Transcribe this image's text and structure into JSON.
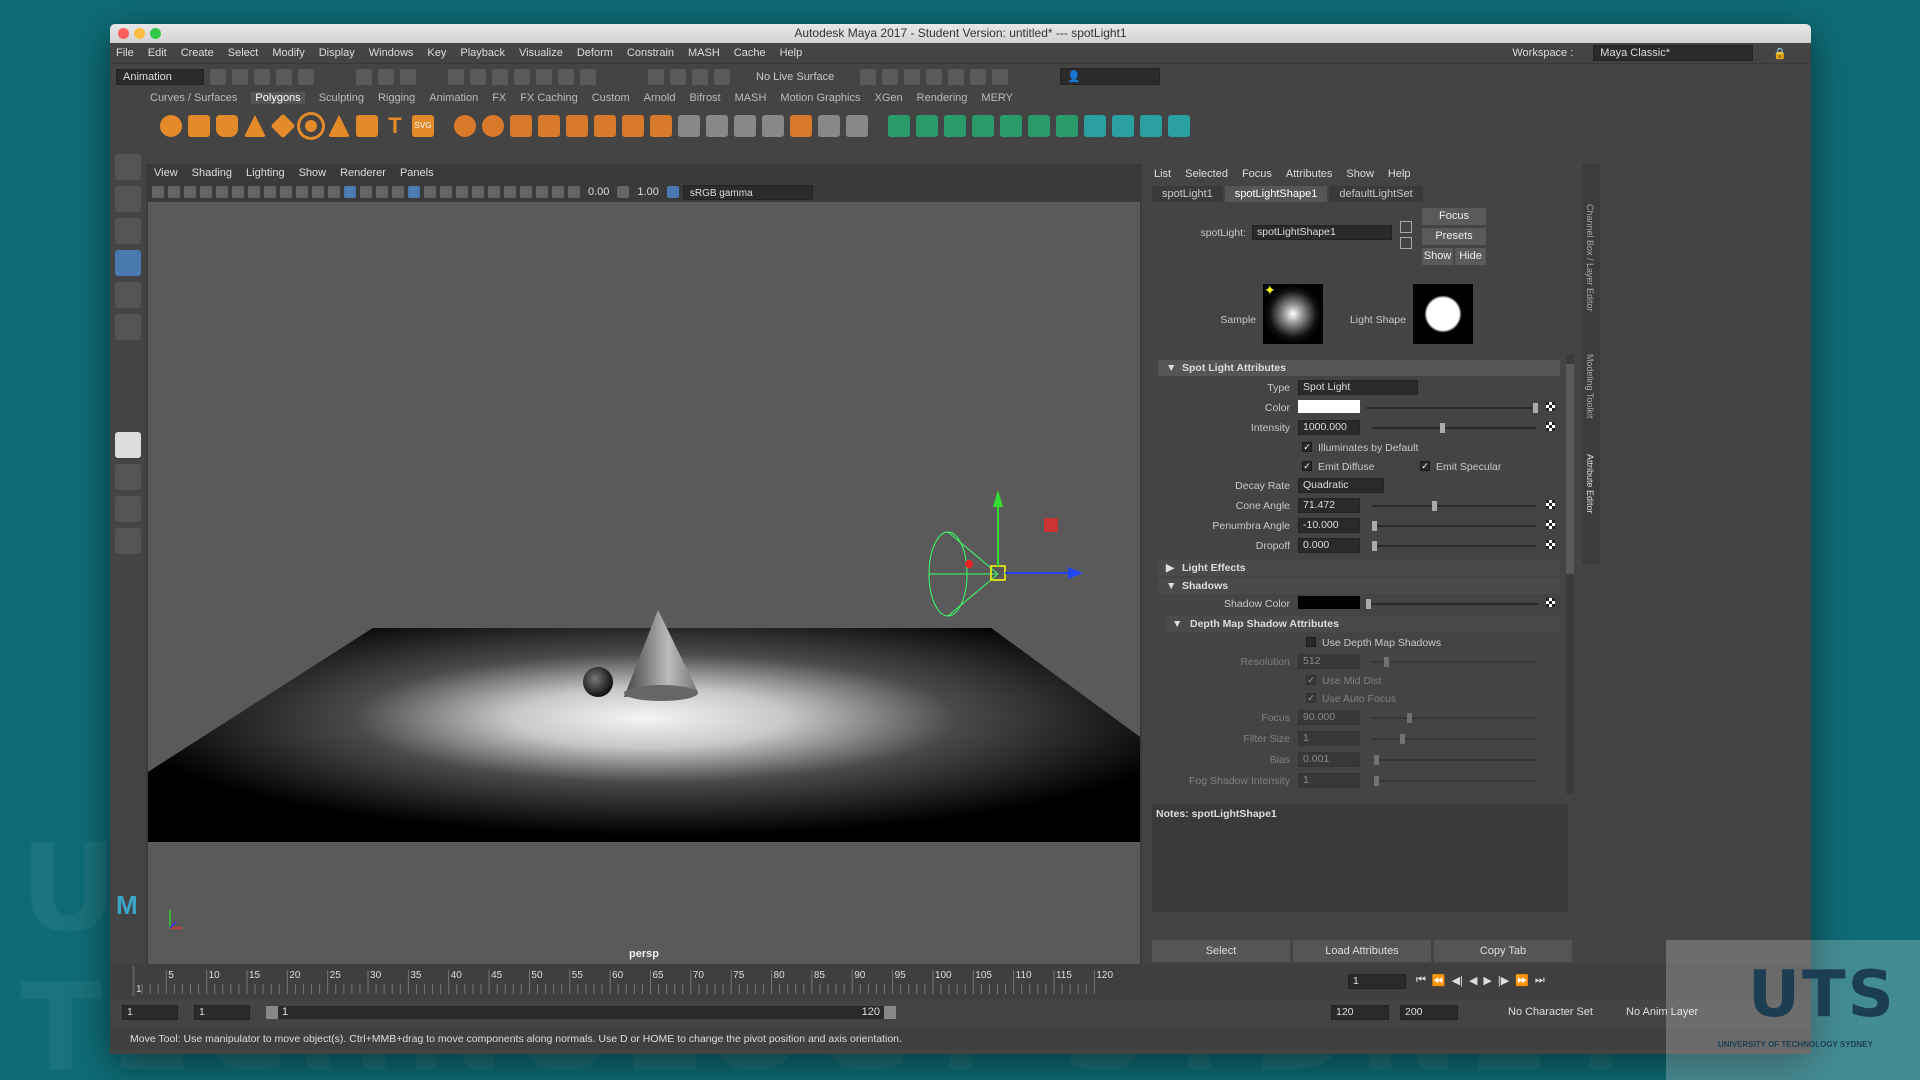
{
  "window": {
    "title": "Autodesk Maya 2017 - Student Version: untitled*   ---   spotLight1"
  },
  "menus": [
    "File",
    "Edit",
    "Create",
    "Select",
    "Modify",
    "Display",
    "Windows",
    "Key",
    "Playback",
    "Visualize",
    "Deform",
    "Constrain",
    "MASH",
    "Cache",
    "Help"
  ],
  "workspace": {
    "label": "Workspace :",
    "value": "Maya Classic*"
  },
  "status_line": {
    "mode": "Animation",
    "live_surface": "No Live Surface"
  },
  "shelf_tabs": [
    "Curves / Surfaces",
    "Polygons",
    "Sculpting",
    "Rigging",
    "Animation",
    "FX",
    "FX Caching",
    "Custom",
    "Arnold",
    "Bifrost",
    "MASH",
    "Motion Graphics",
    "XGen",
    "Rendering",
    "MERY"
  ],
  "shelf_active": "Polygons",
  "viewport": {
    "menus": [
      "View",
      "Shading",
      "Lighting",
      "Show",
      "Renderer",
      "Panels"
    ],
    "field1": "0.00",
    "field2": "1.00",
    "colorspace": "sRGB gamma",
    "camera_label": "persp"
  },
  "attr_editor": {
    "menus": [
      "List",
      "Selected",
      "Focus",
      "Attributes",
      "Show",
      "Help"
    ],
    "tabs": [
      "spotLight1",
      "spotLightShape1",
      "defaultLightSet"
    ],
    "active_tab": "spotLightShape1",
    "node_label": "spotLight:",
    "node_value": "spotLightShape1",
    "btn_focus": "Focus",
    "btn_presets": "Presets",
    "btn_show": "Show",
    "btn_hide": "Hide",
    "sample_label": "Sample",
    "light_shape_label": "Light Shape",
    "sections": {
      "spot": "Spot Light Attributes",
      "effects": "Light Effects",
      "shadows": "Shadows",
      "depth": "Depth Map Shadow Attributes"
    },
    "fields": {
      "type_label": "Type",
      "type_value": "Spot Light",
      "color_label": "Color",
      "intensity_label": "Intensity",
      "intensity_value": "1000.000",
      "illum_label": "Illuminates by Default",
      "diffuse_label": "Emit Diffuse",
      "specular_label": "Emit Specular",
      "decay_label": "Decay Rate",
      "decay_value": "Quadratic",
      "cone_label": "Cone Angle",
      "cone_value": "71.472",
      "penumbra_label": "Penumbra Angle",
      "penumbra_value": "-10.000",
      "dropoff_label": "Dropoff",
      "dropoff_value": "0.000",
      "shadow_color_label": "Shadow Color",
      "use_depth_label": "Use Depth Map Shadows",
      "resolution_label": "Resolution",
      "resolution_value": "512",
      "mid_dist_label": "Use Mid Dist",
      "auto_focus_label": "Use Auto Focus",
      "focus_label": "Focus",
      "focus_value": "90.000",
      "filter_label": "Filter Size",
      "filter_value": "1",
      "bias_label": "Bias",
      "bias_value": "0.001",
      "fog_label": "Fog Shadow Intensity",
      "fog_value": "1"
    },
    "notes_label": "Notes:  spotLightShape1",
    "bottom_buttons": [
      "Select",
      "Load Attributes",
      "Copy Tab"
    ],
    "side_tabs": [
      "Channel Box / Layer Editor",
      "Modeling Toolkit",
      "Attribute Editor"
    ]
  },
  "timeline": {
    "ticks": [
      "5",
      "10",
      "15",
      "20",
      "25",
      "30",
      "35",
      "40",
      "45",
      "50",
      "55",
      "60",
      "65",
      "70",
      "75",
      "80",
      "85",
      "90",
      "95",
      "100",
      "105",
      "110",
      "115",
      "120"
    ],
    "start_tick": "1",
    "current_frame": "1"
  },
  "range": {
    "start": "1",
    "start2": "1",
    "slider_start": "1",
    "slider_end": "120",
    "end": "120",
    "end2": "200",
    "character_set": "No Character Set",
    "anim_layer": "No Anim Layer"
  },
  "help_line": "Move Tool: Use manipulator to move object(s). Ctrl+MMB+drag to move components along normals. Use D or HOME to change the pivot position and axis orientation.",
  "watermark": {
    "logo": "UTS",
    "sub": "UNIVERSITY OF TECHNOLOGY SYDNEY"
  }
}
